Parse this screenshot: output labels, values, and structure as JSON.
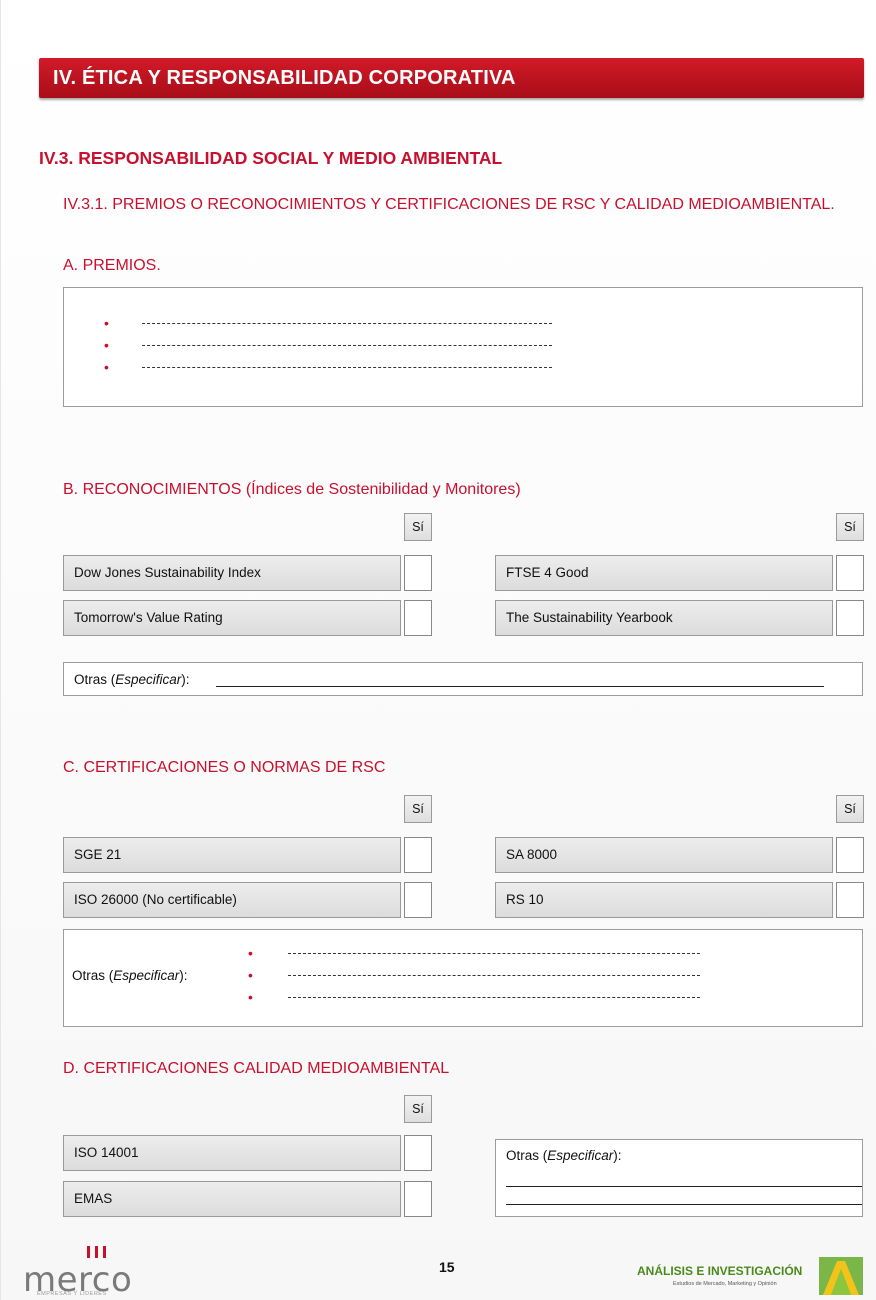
{
  "banner": {
    "title": "IV. ÉTICA Y RESPONSABILIDAD CORPORATIVA"
  },
  "section": {
    "title": "IV.3. RESPONSABILIDAD SOCIAL Y MEDIO AMBIENTAL",
    "subtitle": "IV.3.1. PREMIOS O RECONOCIMIENTOS Y CERTIFICACIONES DE RSC Y CALIDAD MEDIOAMBIENTAL."
  },
  "premios": {
    "heading": "A. PREMIOS.",
    "bullet": "•"
  },
  "reconocimientos": {
    "heading": "B. RECONOCIMIENTOS (Índices de Sostenibilidad y Monitores)",
    "si": "Sí",
    "items": [
      "Dow Jones Sustainability Index",
      "FTSE 4 Good",
      "Tomorrow's Value Rating",
      "The Sustainability Yearbook"
    ],
    "otras_prefix": "Otras (",
    "otras_em": "Especificar",
    "otras_suffix": "):"
  },
  "certificaciones_rsc": {
    "heading": "C. CERTIFICACIONES O NORMAS DE RSC",
    "si": "Sí",
    "items": [
      "SGE 21",
      "SA 8000",
      "ISO 26000 (No certificable)",
      "RS 10"
    ],
    "otras_prefix": "Otras (",
    "otras_em": "Especificar",
    "otras_suffix": "):",
    "bullet": "•"
  },
  "calidad": {
    "heading": "D. CERTIFICACIONES CALIDAD MEDIOAMBIENTAL",
    "si": "Sí",
    "items": [
      "ISO 14001",
      "EMAS"
    ],
    "otras_prefix": "Otras (",
    "otras_em": "Especificar",
    "otras_suffix": "):"
  },
  "footer": {
    "page_number": "15",
    "merco_logo": "merco",
    "merco_tagline": "EMPRESAS Y LÍDERES",
    "ai_name": "ANÁLISIS E INVESTIGACIÓN",
    "ai_tagline": "Estudios de Mercado, Marketing y Opinión"
  },
  "colors": {
    "accent": "#c8102e",
    "banner": "#b5121e",
    "ai_green": "#4a8a1a"
  }
}
